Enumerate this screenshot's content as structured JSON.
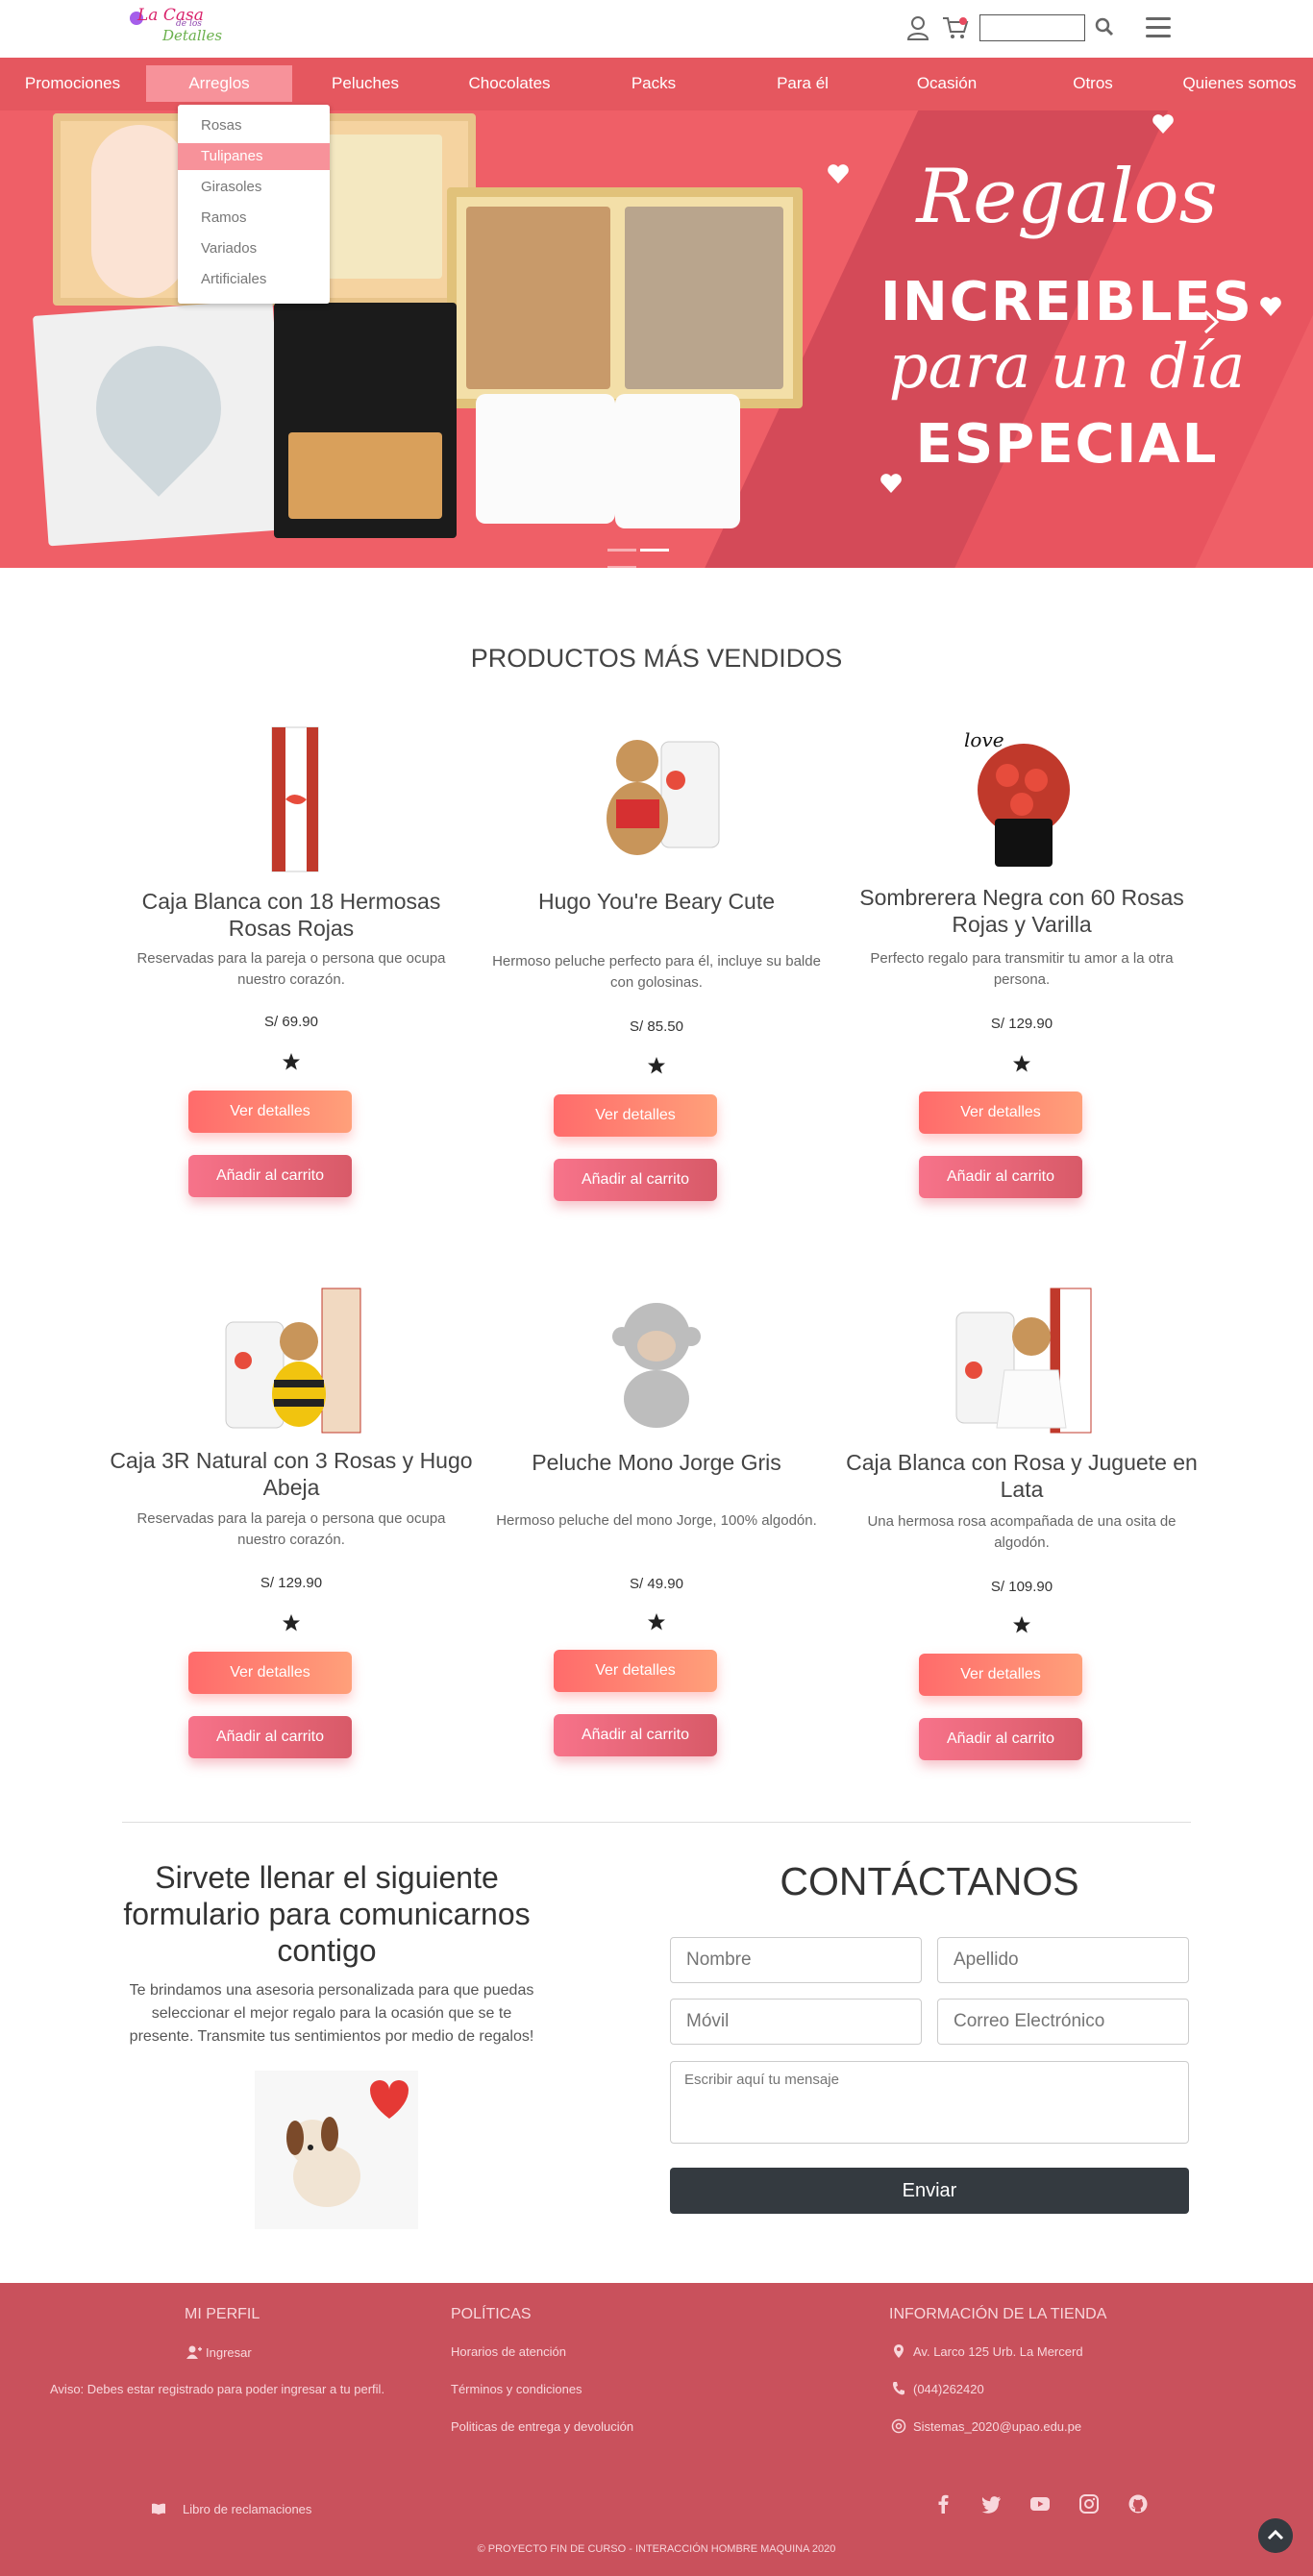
{
  "brand": {
    "logo_line1": "La Casa",
    "logo_line2": "de los",
    "logo_line3": "Detalles"
  },
  "header": {
    "search_placeholder": "",
    "cart_count_color": "#e84a5f"
  },
  "nav": {
    "items": [
      {
        "label": "Promociones"
      },
      {
        "label": "Arreglos"
      },
      {
        "label": "Peluches"
      },
      {
        "label": "Chocolates"
      },
      {
        "label": "Packs"
      },
      {
        "label": "Para él"
      },
      {
        "label": "Ocasión"
      },
      {
        "label": "Otros"
      },
      {
        "label": "Quienes somos"
      }
    ],
    "active": "Arreglos"
  },
  "dropdown": {
    "items": [
      {
        "label": "Rosas"
      },
      {
        "label": "Tulipanes"
      },
      {
        "label": "Girasoles"
      },
      {
        "label": "Ramos"
      },
      {
        "label": "Variados"
      },
      {
        "label": "Artificiales"
      }
    ],
    "highlighted": "Tulipanes"
  },
  "hero": {
    "line1": "Regalos",
    "line2": "INCREIBLES",
    "line3": "para un día",
    "line4": "ESPECIAL",
    "slides": 3,
    "active_slide": 2,
    "colors": {
      "bg": "#ef5f67",
      "stripe": "#d44a58"
    }
  },
  "bestsellers": {
    "title": "PRODUCTOS MÁS VENDIDOS",
    "products": [
      {
        "name": "Caja Blanca con 18 Hermosas Rosas Rojas",
        "desc": "Reservadas para la pareja o persona que ocupa nuestro corazón.",
        "price": "S/ 69.90",
        "rating": 1
      },
      {
        "name": "Hugo You're Beary Cute",
        "desc": "Hermoso peluche perfecto para él, incluye su balde con golosinas.",
        "price": "S/ 85.50",
        "rating": 1
      },
      {
        "name": "Sombrerera Negra con 60 Rosas Rojas y Varilla",
        "desc": "Perfecto regalo para transmitir tu amor a la otra persona.",
        "price": "S/ 129.90",
        "rating": 1
      },
      {
        "name": "Caja 3R Natural con 3 Rosas y Hugo Abeja",
        "desc": "Reservadas para la pareja o persona que ocupa nuestro corazón.",
        "price": "S/ 129.90",
        "rating": 1
      },
      {
        "name": "Peluche Mono Jorge Gris",
        "desc": "Hermoso peluche del mono Jorge, 100% algodón.",
        "price": "S/ 49.90",
        "rating": 1
      },
      {
        "name": "Caja Blanca con Rosa y Juguete en Lata",
        "desc": "Una hermosa rosa acompañada de una osita de algodón.",
        "price": "S/ 109.90",
        "rating": 1
      }
    ],
    "details_label": "Ver detalles",
    "add_label": "Añadir al carrito"
  },
  "form_section": {
    "left_title": "Sirvete llenar el siguiente formulario para comunicarnos contigo",
    "left_desc": "Te brindamos una asesoria personalizada para que puedas seleccionar el mejor regalo para la ocasión que se te presente. Transmite tus sentimientos por medio de regalos!",
    "contact_title": "CONTÁCTANOS",
    "name_placeholder": "Nombre",
    "lastname_placeholder": "Apellido",
    "phone_placeholder": "Móvil",
    "email_placeholder": "Correo Electrónico",
    "message_placeholder": "Escribir aquí tu mensaje",
    "send_label": "Enviar"
  },
  "footer": {
    "profile_head": "MI PERFIL",
    "login_label": "Ingresar",
    "login_notice": "Aviso: Debes estar registrado para poder ingresar a tu perfil.",
    "policies_head": "POLÍTICAS",
    "policies": [
      "Horarios de atención",
      "Términos y condiciones",
      "Politicas de entrega y devolución"
    ],
    "store_head": "INFORMACIÓN DE LA TIENDA",
    "address": "Av. Larco 125 Urb. La Mercerd",
    "phone": "(044)262420",
    "email": "Sistemas_2020@upao.edu.pe",
    "complaints": "Libro de reclamaciones",
    "social": [
      "facebook",
      "twitter",
      "youtube",
      "instagram",
      "github"
    ],
    "copyright": "© PROYECTO FIN DE CURSO - INTERACCIÓN HOMBRE MAQUINA 2020",
    "bg_color": "#c9515c"
  }
}
